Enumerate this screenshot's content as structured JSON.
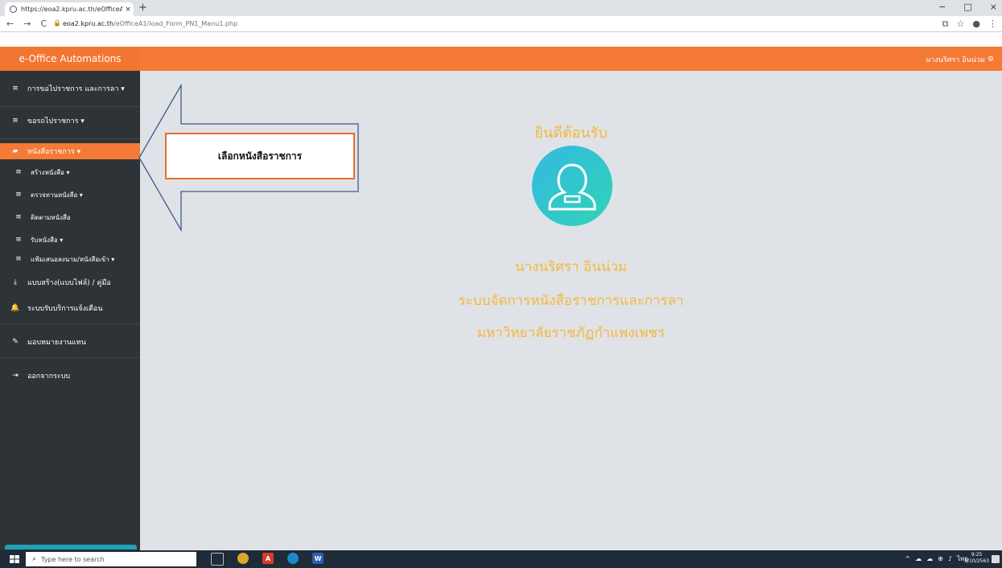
{
  "browser": {
    "tab_title": "https://eoa2.kpru.ac.th/eOfficeA",
    "tab_close": "×",
    "new_tab": "+",
    "url_host": "eoa2.kpru.ac.th",
    "url_path": "/eOfficeA1/load_Form_PN1_Manu1.php",
    "window_controls": [
      "−",
      "□",
      "×"
    ]
  },
  "header": {
    "brand": "e-Office Automations",
    "user": "นางนริศรา อินน่วม"
  },
  "sidebar": {
    "items": [
      {
        "label": "การขอไปราชการ และการลา ▾",
        "icon": "list-icon"
      },
      {
        "label": "ขอรถไปราชการ ▾",
        "icon": "list-icon"
      },
      {
        "label": "หนังสือราชการ ▾",
        "icon": "book-icon"
      },
      {
        "label": "สร้างหนังสือ ▾",
        "icon": "list-icon"
      },
      {
        "label": "ตรวจทานหนังสือ ▾",
        "icon": "list-icon"
      },
      {
        "label": "ติดตามหนังสือ",
        "icon": "list-icon"
      },
      {
        "label": "รับหนังสือ ▾",
        "icon": "list-icon"
      },
      {
        "label": "แฟ้มเสนอลงนาม/หนังสือเข้า ▾",
        "icon": "list-icon"
      },
      {
        "label": "แบบสร้าง(แบบไฟล์) / คู่มือ",
        "icon": "download-icon"
      },
      {
        "label": "ระบบรับบริการแจ้งเตือน",
        "icon": "bell-icon"
      },
      {
        "label": "มอบหมายงานแทน",
        "icon": "edit-icon"
      },
      {
        "label": "ออกจากระบบ",
        "icon": "logout-icon"
      }
    ]
  },
  "main": {
    "welcome": "ยินดีต้อนรับ",
    "user_name": "นางนริศรา อินน่วม",
    "system_name": "ระบบจัดการหนังสือราชการและการลา",
    "university": "มหาวิทยาลัยราชภัฏกำแพงเพชร"
  },
  "annotation": {
    "text": "เลือกหนังสือราชการ",
    "color": "#e46d2a"
  },
  "taskbar": {
    "search_placeholder": "Type here to search",
    "time": "9:25",
    "date": "8/10/2563",
    "lang": "ไทย"
  }
}
